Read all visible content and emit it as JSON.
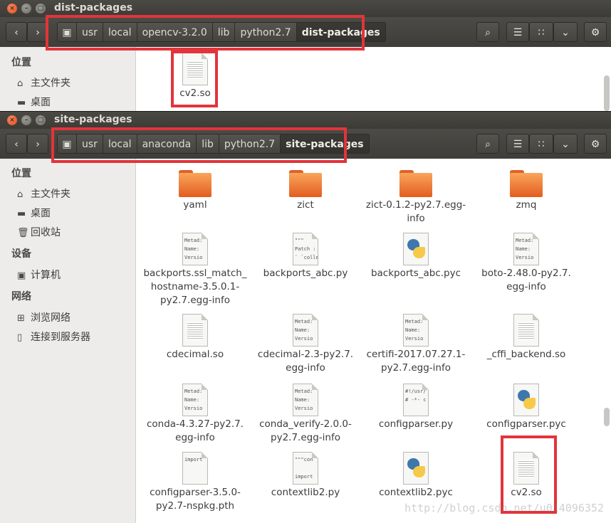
{
  "back_window": {
    "title": "dist-packages",
    "crumbs": [
      "usr",
      "local",
      "opencv-3.2.0",
      "lib",
      "python2.7",
      "dist-packages"
    ],
    "sidebar_heading": "位置",
    "sidebar_items": [
      "主文件夹",
      "桌面"
    ],
    "files": [
      "cv2.so"
    ]
  },
  "front_window": {
    "title": "site-packages",
    "crumbs": [
      "usr",
      "local",
      "anaconda",
      "lib",
      "python2.7",
      "site-packages"
    ],
    "sidebar": {
      "places_heading": "位置",
      "home": "主文件夹",
      "desktop": "桌面",
      "trash": "回收站",
      "devices_heading": "设备",
      "computer": "计算机",
      "network_heading": "网络",
      "browse_network": "浏览网络",
      "connect_server": "连接到服务器"
    },
    "files": [
      [
        "yaml"
      ],
      [
        "zict"
      ],
      [
        "zict-0.1.2-py2.7.egg-",
        "info"
      ],
      [
        "zmq"
      ],
      [
        "backports.ssl_match_",
        "hostname-3.5.0.1-",
        "py2.7.egg-info"
      ],
      [
        "backports_abc.py"
      ],
      [
        "backports_abc.pyc"
      ],
      [
        "boto-2.48.0-py2.7.",
        "egg-info"
      ],
      [
        "cdecimal.so"
      ],
      [
        "cdecimal-2.3-py2.7.",
        "egg-info"
      ],
      [
        "certifi-2017.07.27.1-",
        "py2.7.egg-info"
      ],
      [
        "_cffi_backend.so"
      ],
      [
        "conda-4.3.27-py2.7.",
        "egg-info"
      ],
      [
        "conda_verify-2.0.0-",
        "py2.7.egg-info"
      ],
      [
        "configparser.py"
      ],
      [
        "configparser.pyc"
      ],
      [
        "configparser-3.5.0-",
        "py2.7-nspkg.pth"
      ],
      [
        "contextlib2.py"
      ],
      [
        "contextlib2.pyc"
      ],
      [
        "cv2.so"
      ]
    ],
    "icon_text": {
      "meta": "Metad:\nName:\nVersio",
      "patch": "\"\"\"\nPatch :\n` `colle",
      "shebang": "#!/usr/\n# -*- c",
      "import": "import",
      "contextlib": "\"\"\"con\n\nimport"
    }
  },
  "watermark": "http://blog.csdn.net/u014096352"
}
